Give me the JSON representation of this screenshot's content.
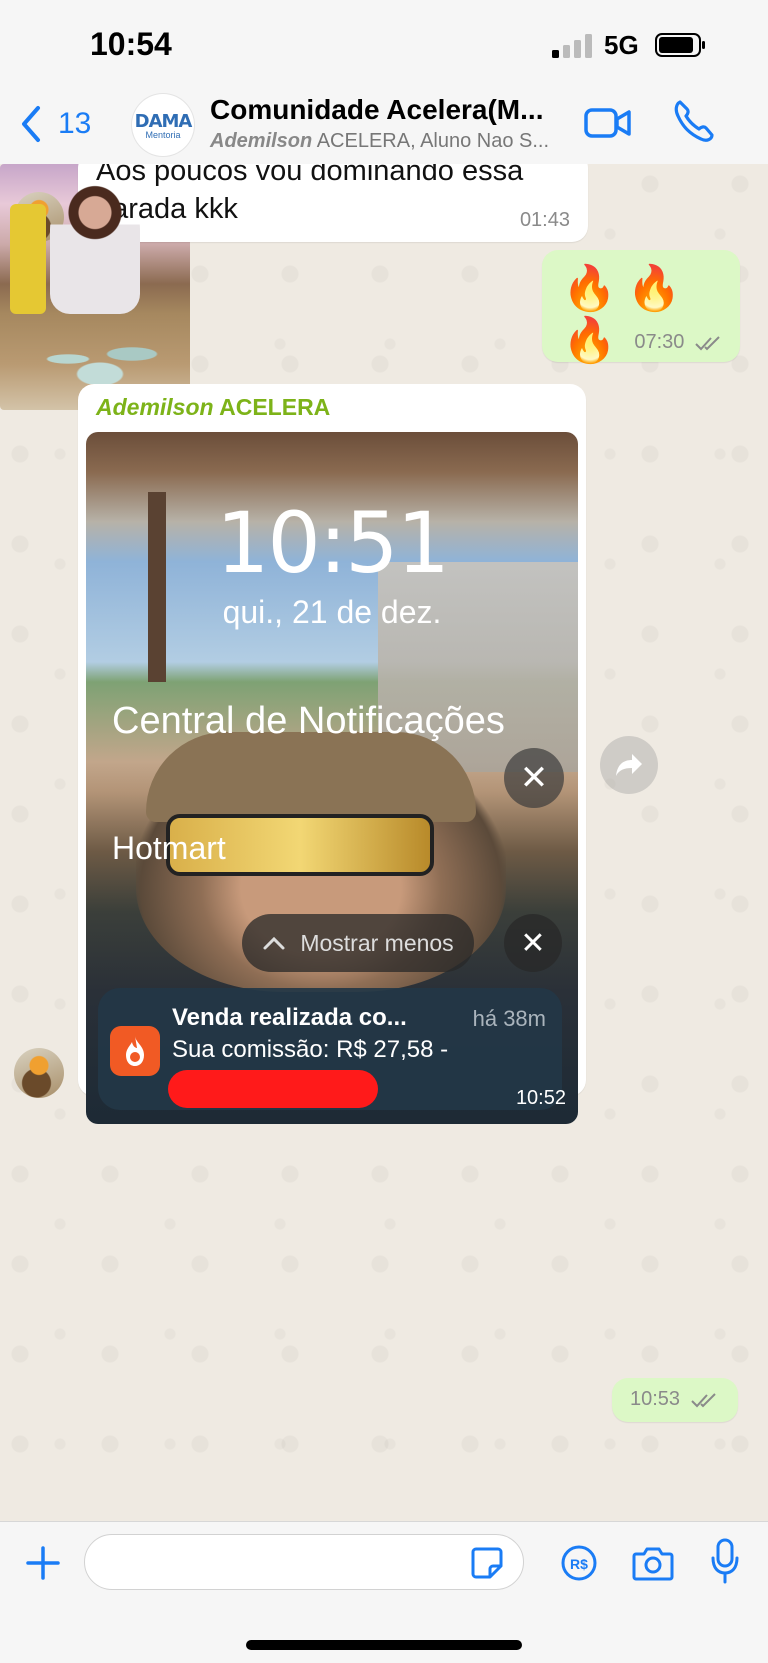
{
  "status_bar": {
    "time": "10:54",
    "network": "5G"
  },
  "header": {
    "back_count": "13",
    "group_avatar_text": "DAMA",
    "group_avatar_sub": "Mentoria",
    "title": "Comunidade Acelera(M...",
    "subtitle_name": "Ademilson",
    "subtitle_rest": "ACELERA, Aluno Nao S..."
  },
  "messages": [
    {
      "text": "Aos poucos vou dominando essa parada kkk",
      "time": "01:43"
    },
    {
      "text": "🔥🔥🔥",
      "time": "07:30"
    },
    {
      "sender_name": "Ademilson",
      "sender_suffix": "ACELERA",
      "screenshot": {
        "lock_time": "10:51",
        "lock_date": "qui., 21 de dez.",
        "center_title": "Central de Notificações",
        "app_name": "Hotmart",
        "show_less": "Mostrar menos",
        "notif_title": "Venda realizada co...",
        "notif_time": "há 38m",
        "notif_body": "Sua comissão: R$ 27,58 -"
      },
      "time": "10:52"
    },
    {
      "time": "10:53"
    }
  ],
  "input": {
    "placeholder": ""
  },
  "colors": {
    "accent": "#1a7cf5",
    "outgoing": "#dcf8c6",
    "sender": "#7db319"
  }
}
